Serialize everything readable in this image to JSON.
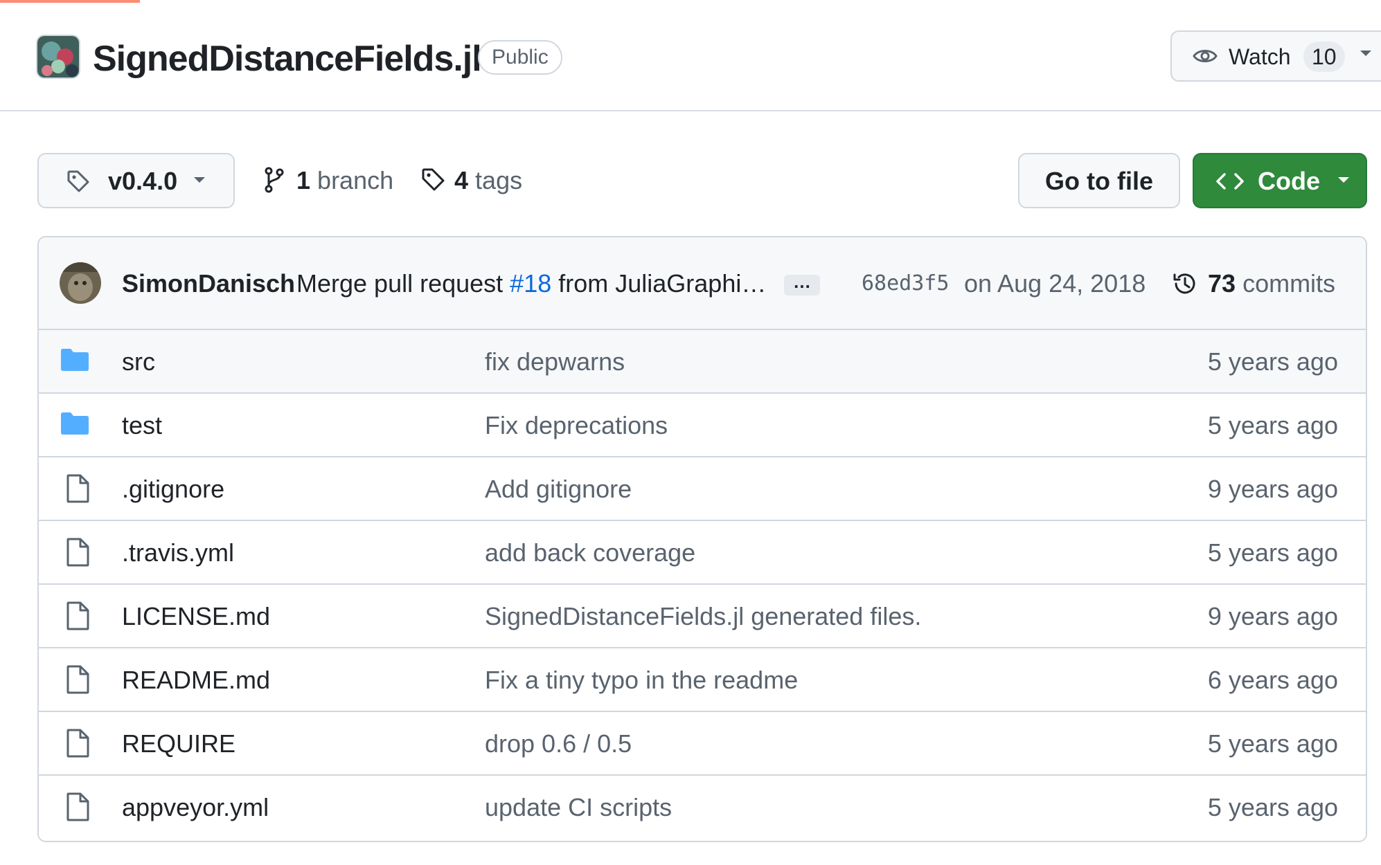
{
  "repo": {
    "name": "SignedDistanceFields.jl",
    "visibility": "Public",
    "watch_label": "Watch",
    "watch_count": "10"
  },
  "toolbar": {
    "branch_selector": "v0.4.0",
    "branches_count": "1",
    "branches_label": "branch",
    "tags_count": "4",
    "tags_label": "tags",
    "go_to_file": "Go to file",
    "code": "Code"
  },
  "latest_commit": {
    "author": "SimonDanisch",
    "message_prefix": "Merge pull request ",
    "pr_number": "#18",
    "message_suffix": " from JuliaGraphi…",
    "ellipsis": "…",
    "sha": "68ed3f5",
    "date": "on Aug 24, 2018",
    "commits_count": "73",
    "commits_label": "commits"
  },
  "files": [
    {
      "type": "folder",
      "name": "src",
      "message": "fix depwarns",
      "age": "5 years ago"
    },
    {
      "type": "folder",
      "name": "test",
      "message": "Fix deprecations",
      "age": "5 years ago"
    },
    {
      "type": "file",
      "name": ".gitignore",
      "message": "Add gitignore",
      "age": "9 years ago"
    },
    {
      "type": "file",
      "name": ".travis.yml",
      "message": "add back coverage",
      "age": "5 years ago"
    },
    {
      "type": "file",
      "name": "LICENSE.md",
      "message": "SignedDistanceFields.jl generated files.",
      "age": "9 years ago"
    },
    {
      "type": "file",
      "name": "README.md",
      "message": "Fix a tiny typo in the readme",
      "age": "6 years ago"
    },
    {
      "type": "file",
      "name": "REQUIRE",
      "message": "drop 0.6 / 0.5",
      "age": "5 years ago"
    },
    {
      "type": "file",
      "name": "appveyor.yml",
      "message": "update CI scripts",
      "age": "5 years ago"
    }
  ],
  "colors": {
    "accent_green": "#2f8a3c",
    "link_blue": "#0969da",
    "folder_blue": "#54aeff",
    "muted_text": "#59636e",
    "border": "#d0d7de"
  },
  "icons": {
    "tag": "tag-icon",
    "branch": "git-branch-icon",
    "eye": "eye-icon",
    "code": "code-icon",
    "history": "history-icon",
    "folder": "folder-icon",
    "file": "file-icon"
  }
}
